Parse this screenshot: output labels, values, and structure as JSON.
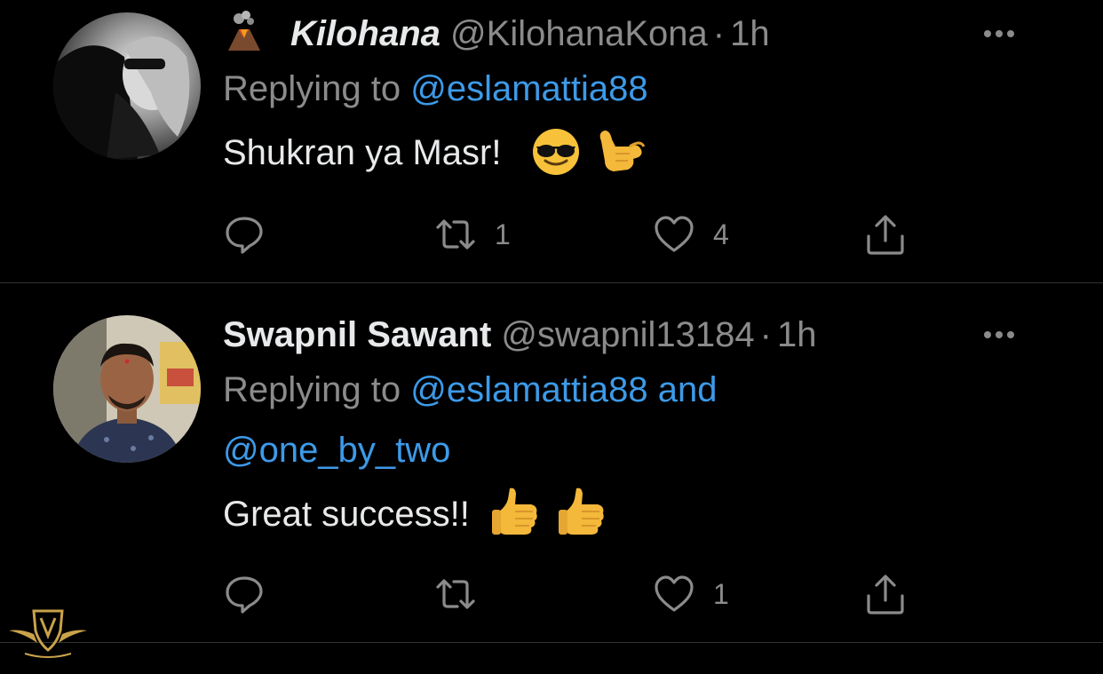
{
  "tweets": [
    {
      "display_name": "Kilohana",
      "name_prefix_icon": "volcano-icon",
      "handle": "@KilohanaKona",
      "separator": "·",
      "time": "1h",
      "replying_prefix": "Replying to",
      "replying_mentions": [
        "@eslamattia88"
      ],
      "text": "Shukran ya Masr!",
      "emojis": [
        "sunglasses-face-icon",
        "call-me-hand-icon"
      ],
      "actions": {
        "reply_count": "",
        "retweet_count": "1",
        "like_count": "4"
      }
    },
    {
      "display_name": "Swapnil Sawant",
      "handle": "@swapnil13184",
      "separator": "·",
      "time": "1h",
      "replying_prefix": "Replying to",
      "replying_mentions": [
        "@eslamattia88",
        "@one_by_two"
      ],
      "replying_joiner": "and",
      "text": "Great success!!",
      "emojis": [
        "thumbs-up-icon",
        "thumbs-up-icon"
      ],
      "actions": {
        "reply_count": "",
        "retweet_count": "",
        "like_count": "1"
      }
    }
  ],
  "colors": {
    "background": "#000000",
    "primary_text": "#e7e9ea",
    "secondary_text": "#8b8b8b",
    "link": "#3d9ae8",
    "divider": "#2f3336"
  }
}
